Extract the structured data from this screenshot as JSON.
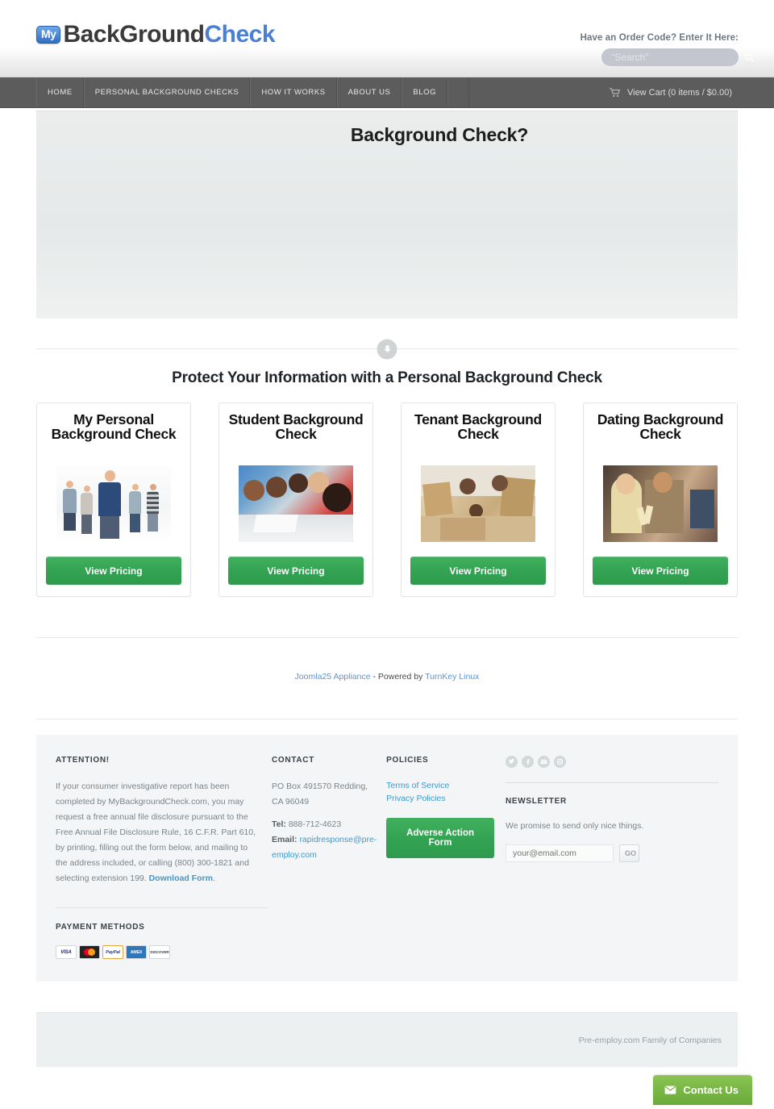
{
  "header": {
    "logo": {
      "badge": "My",
      "dark": "BackGround",
      "blue": "Check"
    },
    "order_code_label": "Have an Order Code? Enter It Here:",
    "search_placeholder": "\"Search\"",
    "search_value": ""
  },
  "nav": {
    "items": [
      {
        "label": "HOME"
      },
      {
        "label": "PERSONAL BACKGROUND CHECKS"
      },
      {
        "label": "HOW IT WORKS"
      },
      {
        "label": "ABOUT US"
      },
      {
        "label": "BLOG"
      }
    ],
    "cart_label": "View Cart (0 items / $0.00)",
    "cart_icon": "shopping-cart-icon"
  },
  "hero": {
    "title": "Background Check?"
  },
  "divider": {
    "icon": "arrow-down-circle-icon"
  },
  "main": {
    "section_title": "Protect Your Information with a Personal Background Check",
    "cards": [
      {
        "title": "My Personal Background Check",
        "button": "View Pricing",
        "image": "group-of-young-people-photo"
      },
      {
        "title": "Student Background Check",
        "button": "View Pricing",
        "image": "students-studying-photo"
      },
      {
        "title": "Tenant Background Check",
        "button": "View Pricing",
        "image": "family-moving-boxes-photo"
      },
      {
        "title": "Dating Background Check",
        "button": "View Pricing",
        "image": "couple-toasting-photo"
      }
    ]
  },
  "credit": {
    "link1": "Joomla25 Appliance",
    "separator": " - Powered by ",
    "link2": "TurnKey Linux"
  },
  "footer": {
    "attention": {
      "heading": "ATTENTION!",
      "body": "If your consumer investigative report has been completed by MyBackgroundCheck.com, you may request a free annual file disclosure pursuant to the Free Annual File Disclosure Rule, 16 C.F.R. Part 610, by printing, filling out the form below, and mailing to the address included, or calling (800) 300-1821 and selecting extension 199.",
      "download_link": "Download Form",
      "period": "."
    },
    "payment": {
      "heading": "PAYMENT METHODS",
      "methods": [
        "VISA",
        "Mastercard",
        "PayPal",
        "American Express",
        "Discover"
      ]
    },
    "contact": {
      "heading": "CONTACT",
      "address": "PO Box 491570 Redding, CA 96049",
      "tel_label": "Tel:",
      "tel": "888-712-4623",
      "email_label": "Email:",
      "email": "rapidresponse@pre-employ.com"
    },
    "policies": {
      "heading": "POLICIES",
      "links": [
        "Terms of Service",
        "Privacy Policies"
      ],
      "button": "Adverse Action Form"
    },
    "social": {
      "icons": [
        "twitter-icon",
        "facebook-icon",
        "email-icon",
        "instagram-icon"
      ]
    },
    "newsletter": {
      "heading": "NEWSLETTER",
      "body": "We promise to send only nice things.",
      "placeholder": "your@email.com",
      "value": "",
      "button": "GO"
    }
  },
  "bottom": {
    "text": "Pre-employ.com Family of Companies",
    "contact_us": "Contact Us",
    "contact_icon": "envelope-icon"
  },
  "colors": {
    "green_button": "#33a353",
    "contact_green": "#77b544",
    "link_blue": "#3d9ad1",
    "nav_bar": "#5c5c5c",
    "logo_blue": "#4a7fd4"
  }
}
